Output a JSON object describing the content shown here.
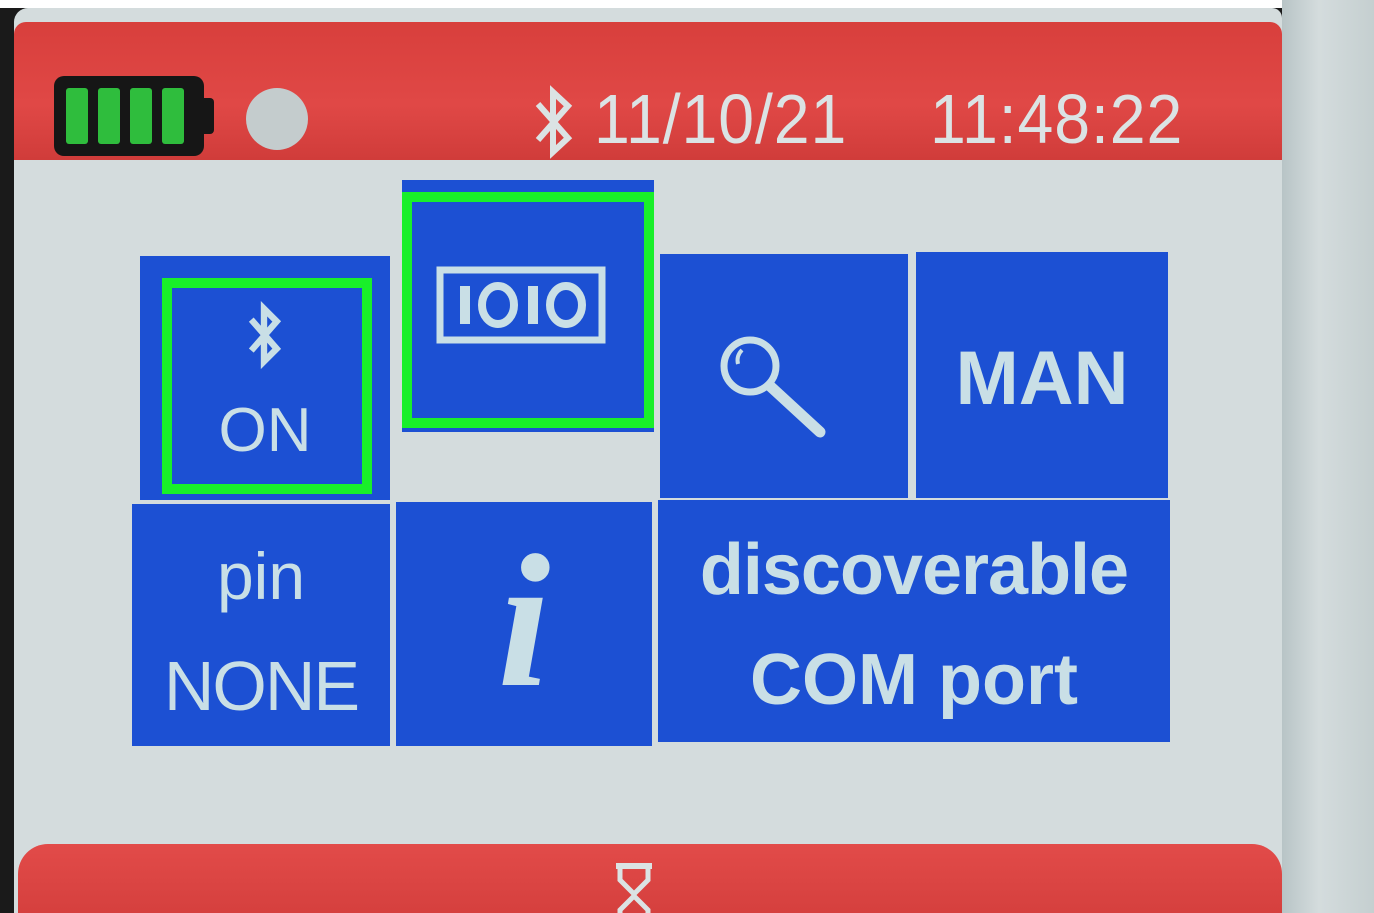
{
  "status_bar": {
    "battery_level": 1.0,
    "bluetooth_icon": "bluetooth-icon",
    "date": "11/10/21",
    "time": "11:48:22"
  },
  "menu": {
    "tiles": [
      {
        "id": "bluetooth-on",
        "icon": "bluetooth-icon",
        "label": "ON",
        "selected": true
      },
      {
        "id": "data-mode",
        "icon": "ioio-icon",
        "selected": true
      },
      {
        "id": "search",
        "icon": "magnifier-icon"
      },
      {
        "id": "mode",
        "label": "MAN"
      },
      {
        "id": "pin",
        "label_top": "pin",
        "label_bottom": "NONE"
      },
      {
        "id": "info",
        "icon": "info-icon",
        "glyph": "i"
      },
      {
        "id": "discoverable",
        "label_top": "discoverable",
        "label_bottom": "COM port"
      }
    ]
  },
  "bottom_bar": {
    "icon": "hourglass-icon"
  },
  "colors": {
    "status_bar": "#e04846",
    "tile": "#1c50d3",
    "tile_text": "#c9dfe6",
    "selection": "#19ef2a",
    "battery": "#2fbd3d",
    "screen": "#d4dcdd"
  }
}
